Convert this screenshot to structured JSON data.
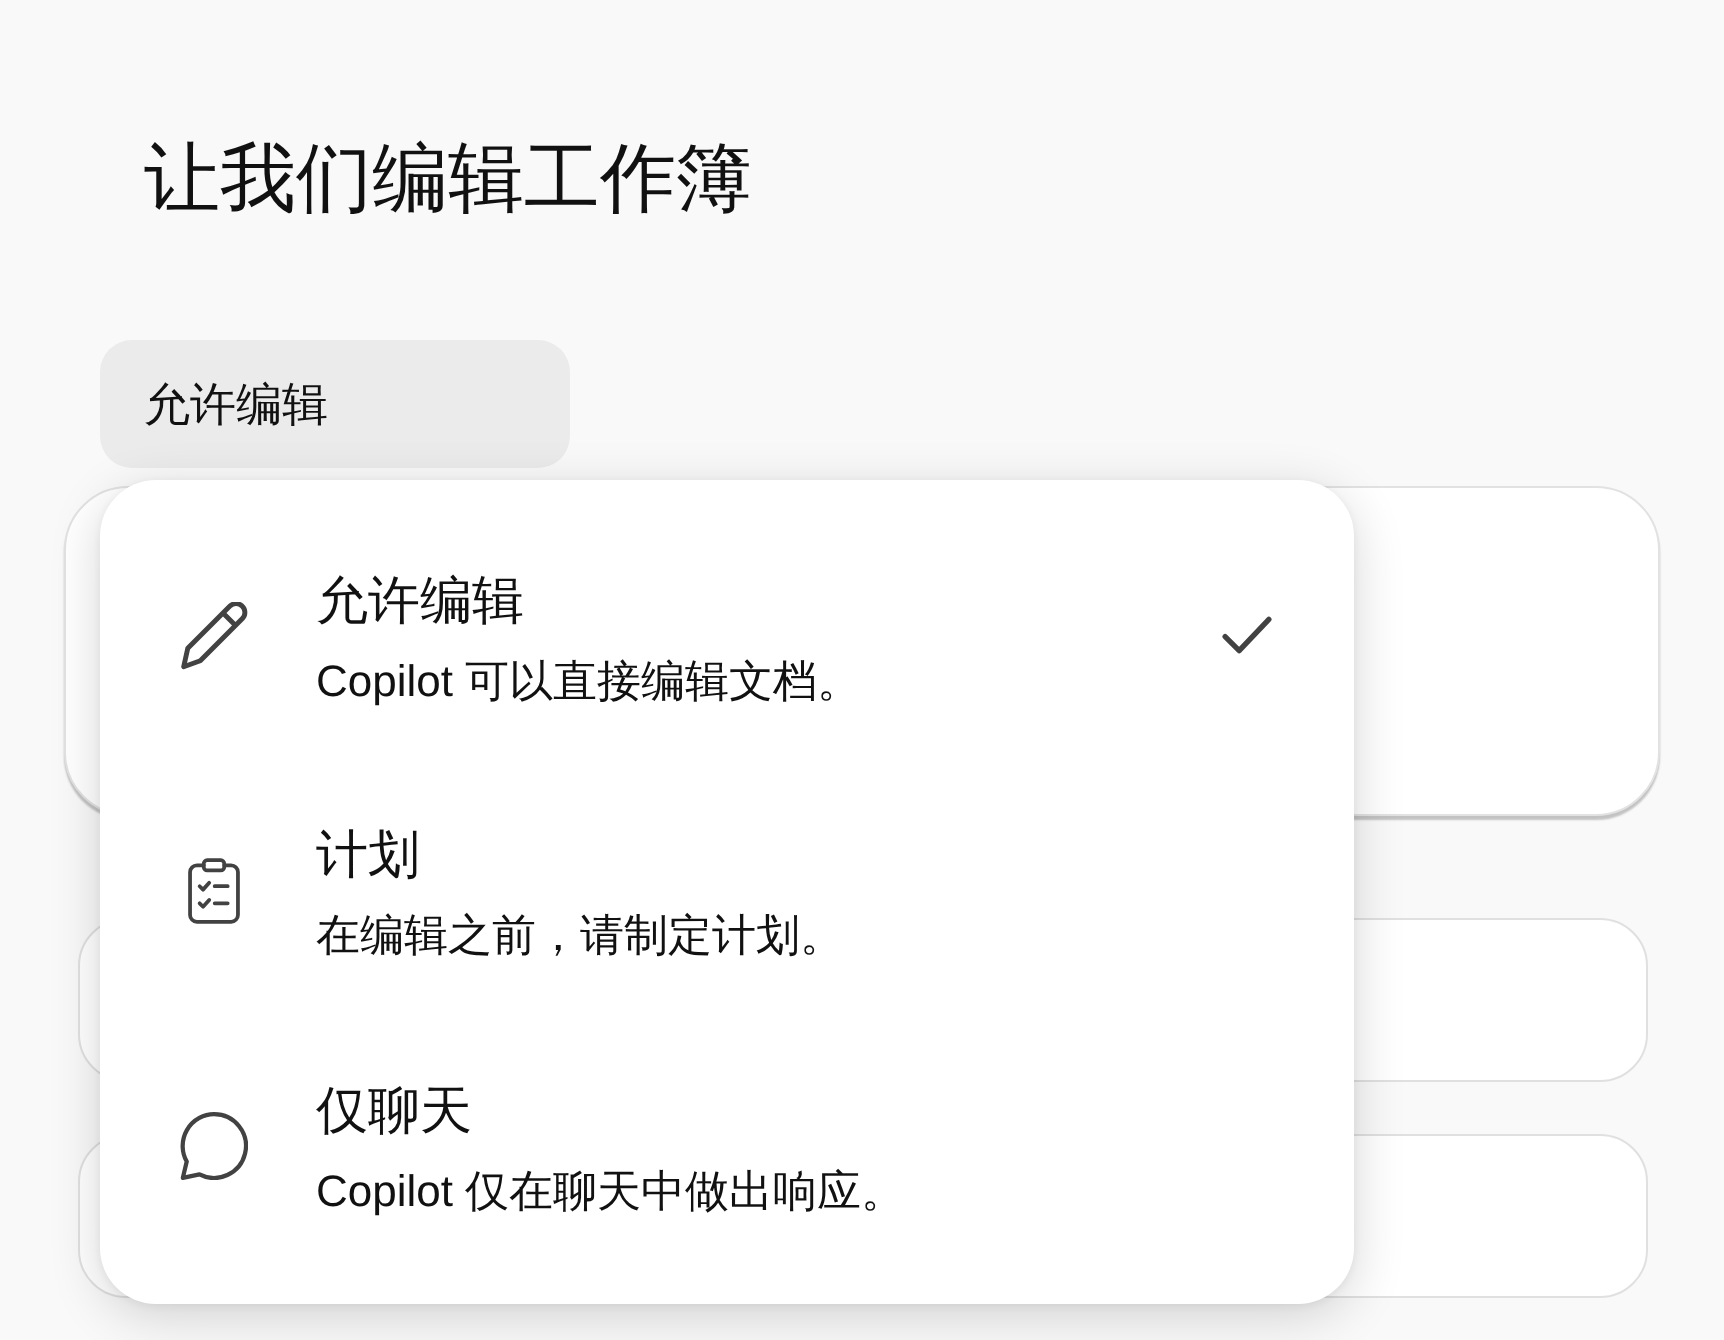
{
  "page": {
    "title": "让我们编辑工作簿"
  },
  "mode_button": {
    "label": "允许编辑"
  },
  "menu": {
    "items": [
      {
        "kind": "edit",
        "title": "允许编辑",
        "description": "Copilot 可以直接编辑文档。",
        "selected": true
      },
      {
        "kind": "plan",
        "title": "计划",
        "description": "在编辑之前，请制定计划。",
        "selected": false
      },
      {
        "kind": "chat",
        "title": "仅聊天",
        "description": "Copilot 仅在聊天中做出响应。",
        "selected": false
      }
    ]
  }
}
